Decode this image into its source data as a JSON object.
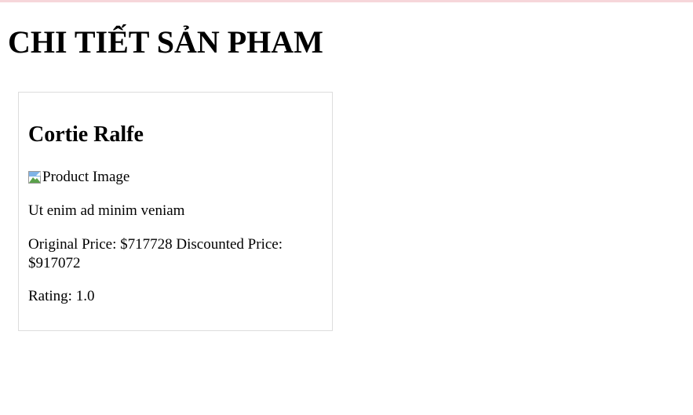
{
  "page": {
    "title": "CHI TIẾT SẢN PHAM"
  },
  "product": {
    "name": "Cortie Ralfe",
    "image_alt": "Product Image",
    "image_icon": "broken-image-icon",
    "description": "Ut enim ad minim veniam",
    "price_text": "Original Price: $717728 Discounted Price: $917072",
    "rating_text": "Rating: 1.0"
  },
  "colors": {
    "top_strip": "#f6d6da",
    "card_border": "#dddddd"
  }
}
